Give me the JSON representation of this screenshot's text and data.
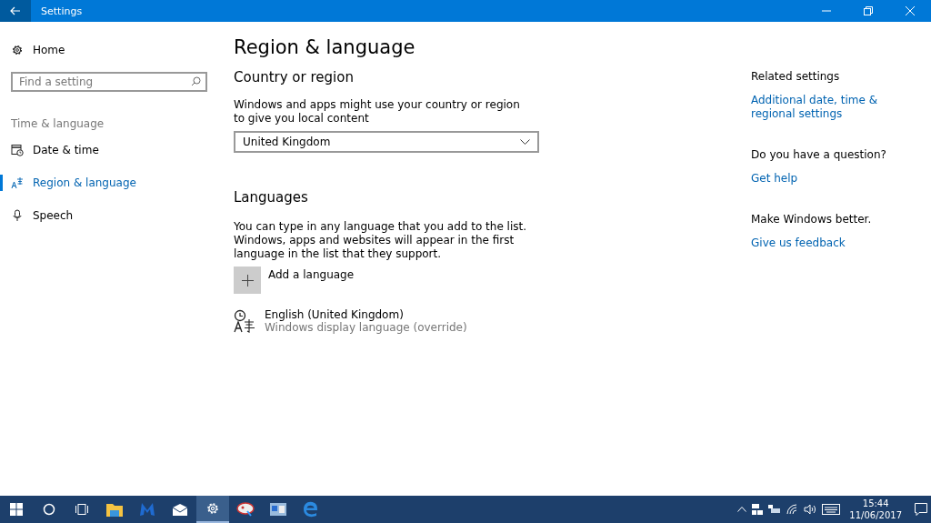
{
  "window": {
    "title": "Settings"
  },
  "sidebar": {
    "home": "Home",
    "search": {
      "placeholder": "Find a setting"
    },
    "section": "Time & language",
    "items": [
      {
        "label": "Date & time",
        "kind": "calendar",
        "selected": false
      },
      {
        "label": "Region & language",
        "kind": "region",
        "selected": true
      },
      {
        "label": "Speech",
        "kind": "microphone",
        "selected": false
      }
    ]
  },
  "main": {
    "title": "Region & language",
    "country": {
      "heading": "Country or region",
      "description": "Windows and apps might use your country or region to give you local content",
      "value": "United Kingdom"
    },
    "languages": {
      "heading": "Languages",
      "description": "You can type in any language that you add to the list. Windows, apps and websites will appear in the first language in the list that they support.",
      "add": "Add a language",
      "items": [
        {
          "name": "English (United Kingdom)",
          "detail": "Windows display language (override)"
        }
      ]
    }
  },
  "related": [
    {
      "heading": "Related settings",
      "link": "Additional date, time & regional settings"
    },
    {
      "heading": "Do you have a question?",
      "link": "Get help"
    },
    {
      "heading": "Make Windows better.",
      "link": "Give us feedback"
    }
  ],
  "taskbar": {
    "apps": [
      {
        "kind": "start",
        "selected": false
      },
      {
        "kind": "search",
        "selected": false
      },
      {
        "kind": "taskview",
        "selected": false
      },
      {
        "kind": "folder",
        "selected": false
      },
      {
        "kind": "shield",
        "selected": false
      },
      {
        "kind": "mail",
        "selected": false
      },
      {
        "kind": "settings",
        "selected": true
      },
      {
        "kind": "paint",
        "selected": false
      },
      {
        "kind": "app",
        "selected": false
      },
      {
        "kind": "browser",
        "selected": false
      }
    ],
    "time": "15:44",
    "date": "11/06/2017"
  }
}
